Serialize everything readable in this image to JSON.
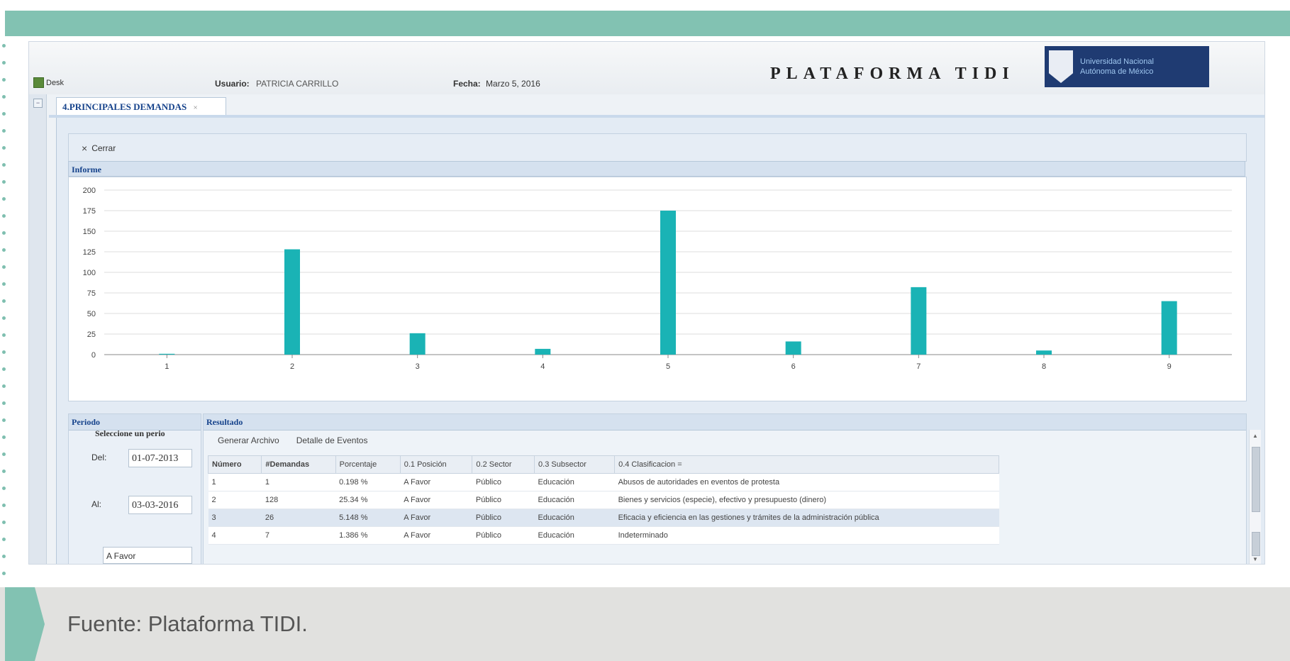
{
  "header": {
    "desk_label": "Desk",
    "user_label": "Usuario:",
    "user_value": "PATRICIA CARRILLO",
    "date_label": "Fecha:",
    "date_value": "Marzo 5, 2016",
    "brand": "PLATAFORMA TIDI",
    "university_line1": "Universidad Nacional",
    "university_line2": "Autónoma de México"
  },
  "tab": {
    "label": "4.PRINCIPALES DEMANDAS",
    "close": "×"
  },
  "toolbar": {
    "close_icon": "×",
    "close_label": "Cerrar"
  },
  "informe": {
    "title": "Informe"
  },
  "chart_data": {
    "type": "bar",
    "categories": [
      "1",
      "2",
      "3",
      "4",
      "5",
      "6",
      "7",
      "8",
      "9"
    ],
    "values": [
      1,
      128,
      26,
      7,
      175,
      16,
      82,
      5,
      65
    ],
    "ylim": [
      0,
      200
    ],
    "yticks": [
      0,
      25,
      50,
      75,
      100,
      125,
      150,
      175,
      200
    ],
    "grid": true,
    "bar_color": "#1ab3b5"
  },
  "periodo": {
    "title": "Periodo",
    "select_label": "Seleccione un perio",
    "del_label": "Del:",
    "del_value": "01-07-2013",
    "al_label": "Al:",
    "al_value": "03-03-2016",
    "position_value": "A Favor"
  },
  "resultado": {
    "title": "Resultado",
    "generar_label": "Generar Archivo",
    "detalle_label": "Detalle de Eventos",
    "columns": [
      "Número",
      "#Demandas",
      "Porcentaje",
      "0.1 Posición",
      "0.2 Sector",
      "0.3 Subsector",
      "0.4 Clasificacion ="
    ],
    "rows": [
      {
        "num": "1",
        "dem": "1",
        "pct": "0.198 %",
        "pos": "A Favor",
        "sector": "Público",
        "sub": "Educación",
        "clas": "Abusos de autoridades en eventos de protesta"
      },
      {
        "num": "2",
        "dem": "128",
        "pct": "25.34 %",
        "pos": "A Favor",
        "sector": "Público",
        "sub": "Educación",
        "clas": "Bienes y servicios (especie), efectivo y presupuesto (dinero)"
      },
      {
        "num": "3",
        "dem": "26",
        "pct": "5.148 %",
        "pos": "A Favor",
        "sector": "Público",
        "sub": "Educación",
        "clas": "Eficacia y eficiencia en las gestiones y trámites de la administración pública"
      },
      {
        "num": "4",
        "dem": "7",
        "pct": "1.386 %",
        "pos": "A Favor",
        "sector": "Público",
        "sub": "Educación",
        "clas": "Indeterminado"
      }
    ]
  },
  "footer": {
    "source": "Fuente: Plataforma TIDI."
  },
  "colors": {
    "accent": "#82c2b2",
    "panel_header": "#15428b"
  }
}
